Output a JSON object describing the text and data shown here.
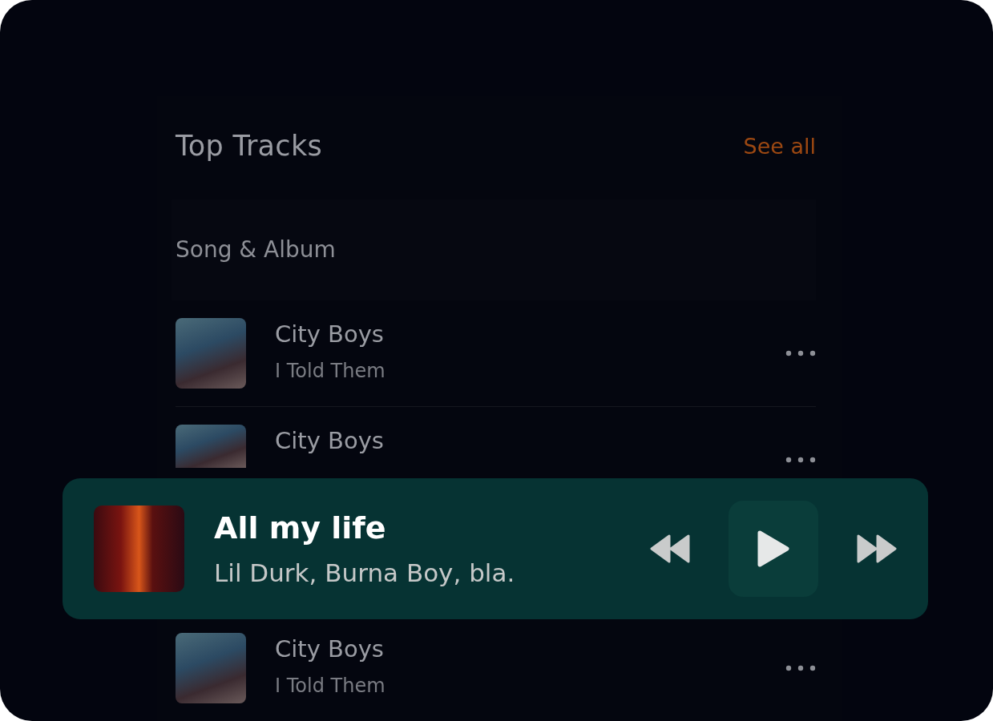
{
  "section": {
    "title": "Top Tracks",
    "link": "See all"
  },
  "table_header": {
    "label": "Song & Album"
  },
  "tracks": [
    {
      "title": "City Boys",
      "album": "I Told Them"
    },
    {
      "title": "City Boys"
    },
    {
      "title": "City Boys",
      "album": "I Told Them"
    }
  ],
  "player": {
    "title": "All my life",
    "artists": "Lil Durk, Burna Boy, bla.",
    "playing": false
  }
}
